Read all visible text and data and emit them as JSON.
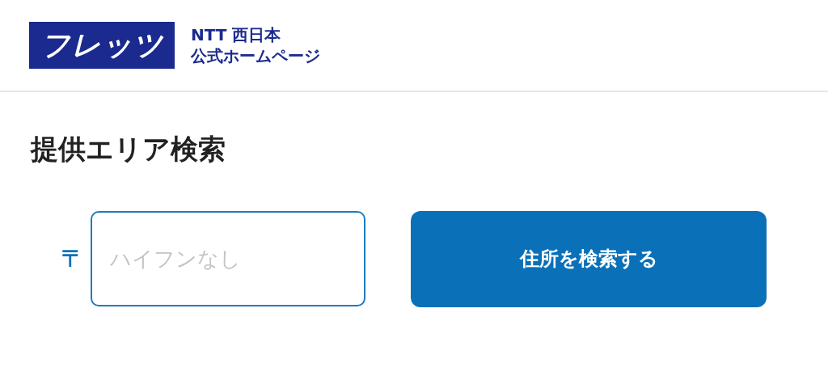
{
  "header": {
    "logo": "フレッツ",
    "company": "NTT 西日本",
    "site": "公式ホームページ"
  },
  "title": "提供エリア検索",
  "search": {
    "postal_mark": "〒",
    "placeholder": "ハイフンなし",
    "button": "住所を検索する"
  }
}
